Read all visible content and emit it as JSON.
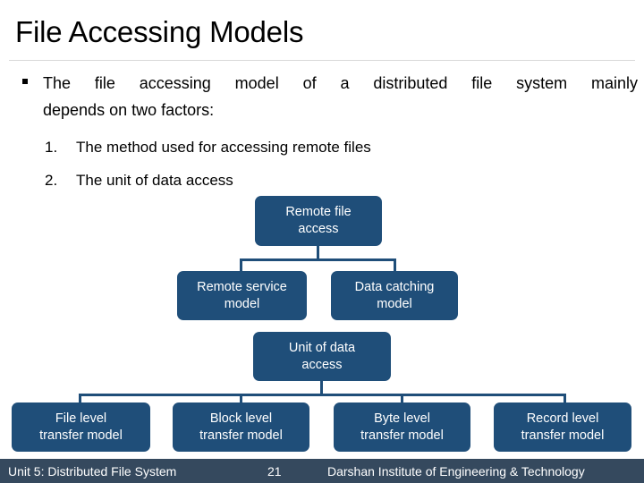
{
  "slide": {
    "title": "File Accessing Models",
    "accent_color": "#1f4e79",
    "footer_color": "#35495e",
    "rule_color": "#d9d9d9"
  },
  "body": {
    "bullet_line1": "The file accessing model of a distributed file system mainly",
    "bullet_line2": "depends on two factors:",
    "numbered": [
      {
        "marker": "1.",
        "text": "The method used for accessing remote files"
      },
      {
        "marker": "2.",
        "text": "The unit of data access"
      }
    ]
  },
  "diagram": {
    "tree1": {
      "root": {
        "line1": "Remote file",
        "line2": "access"
      },
      "children": [
        {
          "line1": "Remote service",
          "line2": "model"
        },
        {
          "line1": "Data catching",
          "line2": "model"
        }
      ]
    },
    "tree2": {
      "root": {
        "line1": "Unit of data",
        "line2": "access"
      },
      "children": [
        {
          "line1": "File level",
          "line2": "transfer model"
        },
        {
          "line1": "Block level",
          "line2": "transfer model"
        },
        {
          "line1": "Byte level",
          "line2": "transfer model"
        },
        {
          "line1": "Record level",
          "line2": "transfer model"
        }
      ]
    }
  },
  "footer": {
    "unit": "Unit 5: Distributed File System",
    "page": "21",
    "organization": "Darshan Institute of Engineering & Technology"
  }
}
